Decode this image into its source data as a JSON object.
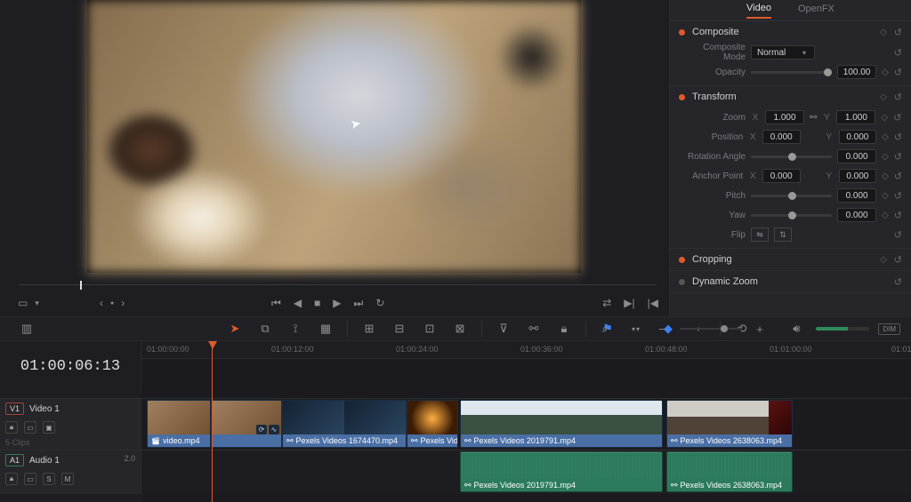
{
  "timecode": "01:00:06:13",
  "inspector": {
    "tabs": {
      "video": "Video",
      "openfx": "OpenFX"
    },
    "composite": {
      "title": "Composite",
      "mode_label": "Composite Mode",
      "mode_value": "Normal",
      "opacity_label": "Opacity",
      "opacity_value": "100.00"
    },
    "transform": {
      "title": "Transform",
      "zoom_label": "Zoom",
      "zoom_x": "1.000",
      "zoom_y": "1.000",
      "position_label": "Position",
      "pos_x": "0.000",
      "pos_y": "0.000",
      "rotation_label": "Rotation Angle",
      "rotation": "0.000",
      "anchor_label": "Anchor Point",
      "anchor_x": "0.000",
      "anchor_y": "0.000",
      "pitch_label": "Pitch",
      "pitch": "0.000",
      "yaw_label": "Yaw",
      "yaw": "0.000",
      "flip_label": "Flip"
    },
    "cropping": {
      "title": "Cropping"
    },
    "dynamic_zoom": {
      "title": "Dynamic Zoom"
    }
  },
  "ruler": {
    "t0": "01:00:00:00",
    "t1": "01:00:12:00",
    "t2": "01:00:24:00",
    "t3": "01:00:36:00",
    "t4": "01:00:48:00",
    "t5": "01:01:00:00",
    "t6": "01:01"
  },
  "tracks": {
    "v1": {
      "badge": "V1",
      "name": "Video 1",
      "sub": "5 Clips",
      "clips": [
        {
          "file": "video.mp4"
        },
        {
          "file": "Pexels Videos 1674470.mp4"
        },
        {
          "file": "Pexels Video…"
        },
        {
          "file": "Pexels Videos 2019791.mp4"
        },
        {
          "file": "Pexels Videos 2638063.mp4"
        }
      ]
    },
    "a1": {
      "badge": "A1",
      "name": "Audio 1",
      "meter": "2.0",
      "clips": [
        {
          "file": "Pexels Videos 2019791.mp4"
        },
        {
          "file": "Pexels Videos 2638063.mp4"
        }
      ]
    }
  },
  "labels": {
    "x": "X",
    "y": "Y",
    "dim": "DIM",
    "s": "S",
    "m": "M"
  }
}
